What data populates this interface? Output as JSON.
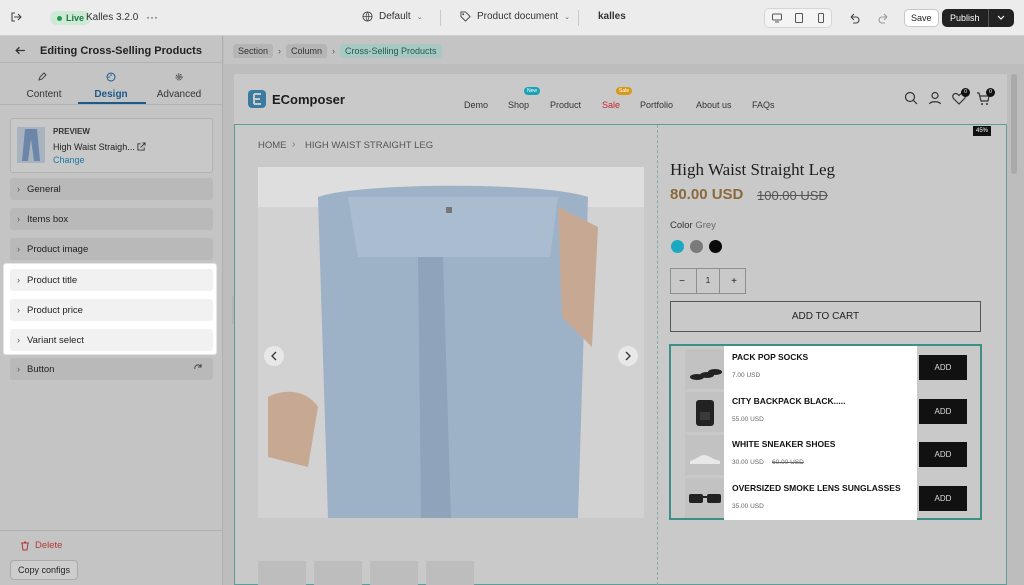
{
  "topbar": {
    "live_label": "Live",
    "theme_name": "Kalles 3.2.0",
    "more_label": "···",
    "language": "Default",
    "document": "Product document",
    "store": "kalles",
    "save_label": "Save",
    "publish_label": "Publish"
  },
  "sidebar": {
    "title": "Editing Cross-Selling Products",
    "tabs": [
      {
        "label": "Content"
      },
      {
        "label": "Design"
      },
      {
        "label": "Advanced"
      }
    ],
    "preview": {
      "heading": "PREVIEW",
      "product": "High Waist Straigh...",
      "change_label": "Change"
    },
    "sections": [
      {
        "label": "General"
      },
      {
        "label": "Items box"
      },
      {
        "label": "Product image"
      },
      {
        "label": "Product title"
      },
      {
        "label": "Product price"
      },
      {
        "label": "Variant select"
      },
      {
        "label": "Button"
      }
    ],
    "delete_label": "Delete",
    "copy_label": "Copy configs"
  },
  "breadcrumb": [
    "Section",
    "Column",
    "Cross-Selling Products"
  ],
  "store": {
    "logo": "EComposer",
    "nav": [
      {
        "label": "Demo"
      },
      {
        "label": "Shop",
        "badge": "New"
      },
      {
        "label": "Product"
      },
      {
        "label": "Sale",
        "badge": "Sale"
      },
      {
        "label": "Portfolio"
      },
      {
        "label": "About us"
      },
      {
        "label": "FAQs"
      }
    ],
    "wishlist_count": "0",
    "cart_count": "0",
    "discount_badge": "45%",
    "page_breadcrumb": [
      "HOME",
      "HIGH WAIST STRAIGHT LEG"
    ],
    "product": {
      "title": "High Waist Straight Leg",
      "price": "80.00 USD",
      "compare_price": "100.00 USD",
      "color_label": "Color",
      "color_value": "Grey",
      "swatches": [
        "#1ba9c2",
        "#7a7a7a",
        "#0a0a0a"
      ],
      "quantity": "1",
      "minus": "−",
      "plus": "+",
      "add_to_cart": "ADD TO CART"
    },
    "cross_sell": [
      {
        "name": "PACK POP SOCKS",
        "price": "7.00 USD",
        "compare": "",
        "add": "ADD"
      },
      {
        "name": "CITY BACKPACK BLACK.....",
        "price": "55.00 USD",
        "compare": "",
        "add": "ADD"
      },
      {
        "name": "WHITE SNEAKER SHOES",
        "price": "30.00 USD",
        "compare": "60.00 USD",
        "add": "ADD"
      },
      {
        "name": "OVERSIZED SMOKE LENS SUNGLASSES",
        "price": "35.00 USD",
        "compare": "",
        "add": "ADD"
      }
    ]
  }
}
